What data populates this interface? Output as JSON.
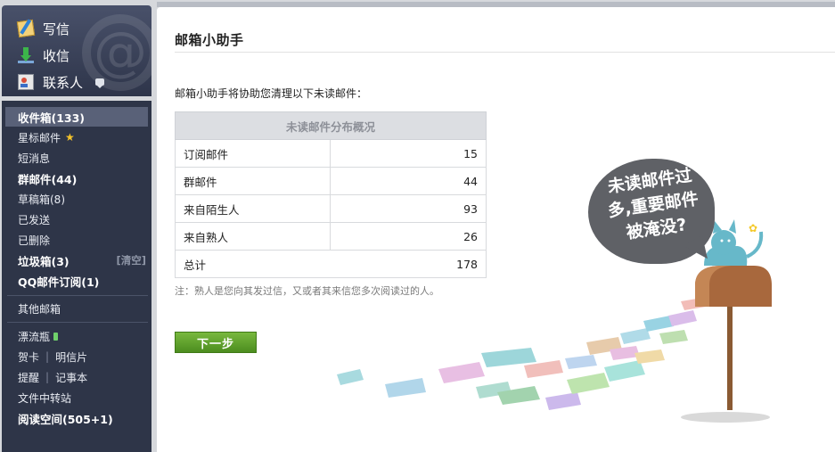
{
  "nav_top": {
    "write": "写信",
    "receive": "收信",
    "contacts": "联系人"
  },
  "nav": {
    "inbox": "收件箱(133)",
    "starred": "星标邮件",
    "sms": "短消息",
    "group": "群邮件(44)",
    "drafts": "草稿箱(8)",
    "sent": "已发送",
    "deleted": "已删除",
    "spam": "垃圾箱(3)",
    "spam_clear": "[清空]",
    "qq_subs": "QQ邮件订阅(1)",
    "other": "其他邮箱",
    "bottle": "漂流瓶",
    "card": "贺卡",
    "postcard": "明信片",
    "reminder": "提醒",
    "notes": "记事本",
    "transfer": "文件中转站",
    "reading": "阅读空间(505+1)"
  },
  "main": {
    "title": "邮箱小助手",
    "intro": "邮箱小助手将协助您清理以下未读邮件：",
    "table_header": "未读邮件分布概况",
    "rows": [
      {
        "label": "订阅邮件",
        "value": "15"
      },
      {
        "label": "群邮件",
        "value": "44"
      },
      {
        "label": "来自陌生人",
        "value": "93"
      },
      {
        "label": "来自熟人",
        "value": "26"
      }
    ],
    "total_label": "总计",
    "total_value": "178",
    "note": "注：熟人是您向其发过信，又或者其来信您多次阅读过的人。",
    "next_button": "下一步",
    "bubble_line1": "未读邮件过",
    "bubble_line2": "多,重要邮件",
    "bubble_line3": "被淹没?"
  }
}
